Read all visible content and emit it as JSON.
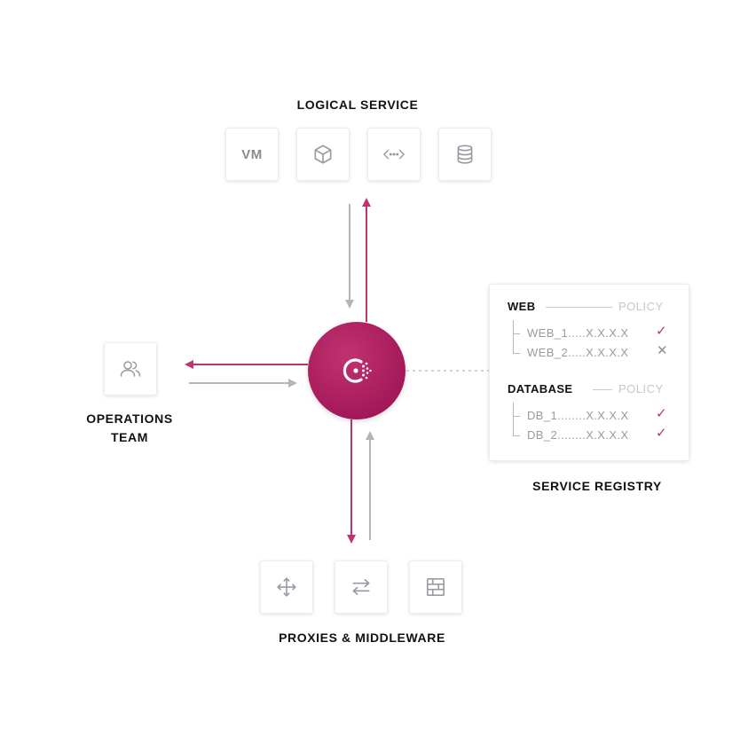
{
  "logical_service": {
    "title": "LOGICAL SERVICE",
    "icons": [
      {
        "kind": "vm",
        "text": "VM"
      },
      {
        "kind": "cube-icon"
      },
      {
        "kind": "code-icon"
      },
      {
        "kind": "database-icon"
      }
    ]
  },
  "operations": {
    "title_line1": "OPERATIONS",
    "title_line2": "TEAM",
    "icon": "users-icon"
  },
  "hub": {
    "icon": "consul-logo-icon"
  },
  "proxies": {
    "title": "PROXIES & MIDDLEWARE",
    "icons": [
      "move-icon",
      "swap-arrows-icon",
      "firewall-icon"
    ]
  },
  "registry": {
    "title": "SERVICE REGISTRY",
    "groups": [
      {
        "name": "WEB",
        "policy": "POLICY",
        "rows": [
          {
            "label": "WEB_1.....X.X.X.X",
            "status": "ok"
          },
          {
            "label": "WEB_2.....X.X.X.X",
            "status": "denied"
          }
        ]
      },
      {
        "name": "DATABASE",
        "policy": "POLICY",
        "rows": [
          {
            "label": "DB_1........X.X.X.X",
            "status": "ok"
          },
          {
            "label": "DB_2........X.X.X.X",
            "status": "ok"
          }
        ]
      }
    ]
  },
  "colors": {
    "accent": "#c0336f",
    "hub": "#a4195a",
    "arrow_gray": "#b4b4bc",
    "text": "#111111",
    "muted": "#9a9aa2"
  }
}
